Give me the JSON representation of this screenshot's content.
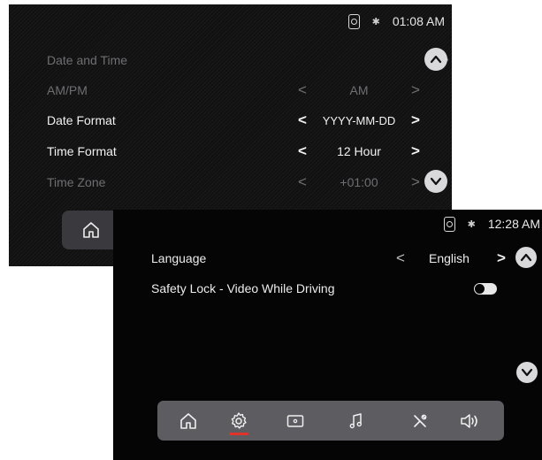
{
  "back_screen": {
    "status": {
      "time": "01:08 AM",
      "bluetooth": "✱",
      "icons": [
        "phone-link-icon",
        "bluetooth-icon"
      ]
    },
    "rows": [
      {
        "label": "Date and Time",
        "value": "",
        "enabled": false
      },
      {
        "label": "AM/PM",
        "value": "AM",
        "enabled": false
      },
      {
        "label": "Date Format",
        "value": "YYYY-MM-DD",
        "enabled": true
      },
      {
        "label": "Time Format",
        "value": "12 Hour",
        "enabled": true
      },
      {
        "label": "Time Zone",
        "value": "+01:00",
        "enabled": false
      }
    ],
    "chevrons": {
      "left": "<",
      "right": ">"
    }
  },
  "front_screen": {
    "status": {
      "time": "12:28 AM",
      "bluetooth": "✱",
      "icons": [
        "phone-link-icon",
        "bluetooth-icon"
      ]
    },
    "rows": [
      {
        "label": "Language",
        "value": "English"
      },
      {
        "label": "Safety Lock - Video While Driving",
        "toggle": "off"
      }
    ],
    "chevrons": {
      "left": "<",
      "right": ">"
    },
    "nav": [
      "home-icon",
      "settings-icon",
      "screen-mirror-icon",
      "music-icon",
      "tools-icon",
      "volume-icon"
    ],
    "active_nav": "settings-icon"
  },
  "colors": {
    "accent": "#e0332b",
    "button": "#d9d9dc",
    "nav_bar": "#5c5c61"
  }
}
